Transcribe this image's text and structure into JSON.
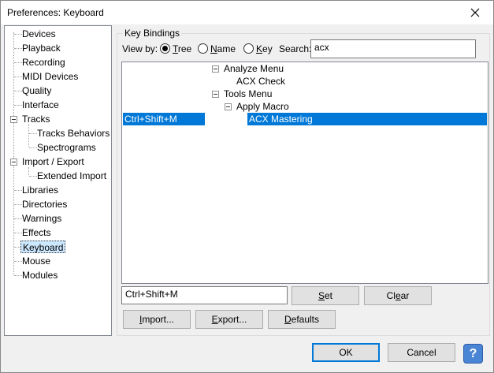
{
  "window": {
    "title": "Preferences: Keyboard"
  },
  "sidebar": {
    "items": [
      {
        "label": "Devices"
      },
      {
        "label": "Playback"
      },
      {
        "label": "Recording"
      },
      {
        "label": "MIDI Devices"
      },
      {
        "label": "Quality"
      },
      {
        "label": "Interface"
      },
      {
        "label": "Tracks"
      },
      {
        "label": "Tracks Behaviors"
      },
      {
        "label": "Spectrograms"
      },
      {
        "label": "Import / Export"
      },
      {
        "label": "Extended Import"
      },
      {
        "label": "Libraries"
      },
      {
        "label": "Directories"
      },
      {
        "label": "Warnings"
      },
      {
        "label": "Effects"
      },
      {
        "label": "Keyboard"
      },
      {
        "label": "Mouse"
      },
      {
        "label": "Modules"
      }
    ],
    "selected": "Keyboard"
  },
  "key_bindings": {
    "group_label": "Key Bindings",
    "view_by_label": "View by:",
    "view_options": [
      {
        "label": "Tree",
        "mnemonic": "T",
        "rest": "ree",
        "checked": true
      },
      {
        "label": "Name",
        "mnemonic": "N",
        "rest": "ame",
        "checked": false
      },
      {
        "label": "Key",
        "mnemonic": "K",
        "rest": "ey",
        "checked": false
      }
    ],
    "search_label": "Search:",
    "search_value": "acx",
    "rows": [
      {
        "key": "",
        "command": "Analyze Menu"
      },
      {
        "key": "",
        "command": "ACX Check"
      },
      {
        "key": "",
        "command": "Tools Menu"
      },
      {
        "key": "",
        "command": "Apply Macro"
      },
      {
        "key": "Ctrl+Shift+M",
        "command": "ACX Mastering"
      }
    ],
    "key_input_value": "Ctrl+Shift+M",
    "set_label": {
      "mnemonic": "S",
      "rest": "et"
    },
    "clear_label": {
      "pre": "Cl",
      "mnemonic": "e",
      "rest": "ar"
    },
    "import_label": {
      "mnemonic": "I",
      "rest": "mport..."
    },
    "export_label": {
      "mnemonic": "E",
      "rest": "xport..."
    },
    "defaults_label": {
      "mnemonic": "D",
      "rest": "efaults"
    }
  },
  "footer": {
    "ok_label": "OK",
    "cancel_label": "Cancel",
    "help_glyph": "?"
  },
  "colors": {
    "selection": "#0078d7",
    "tree_selection": "#cce8ff",
    "help": "#4a84d4"
  },
  "icons": {
    "close": "close-icon",
    "collapse": "minus-box-icon",
    "help": "help-icon"
  }
}
